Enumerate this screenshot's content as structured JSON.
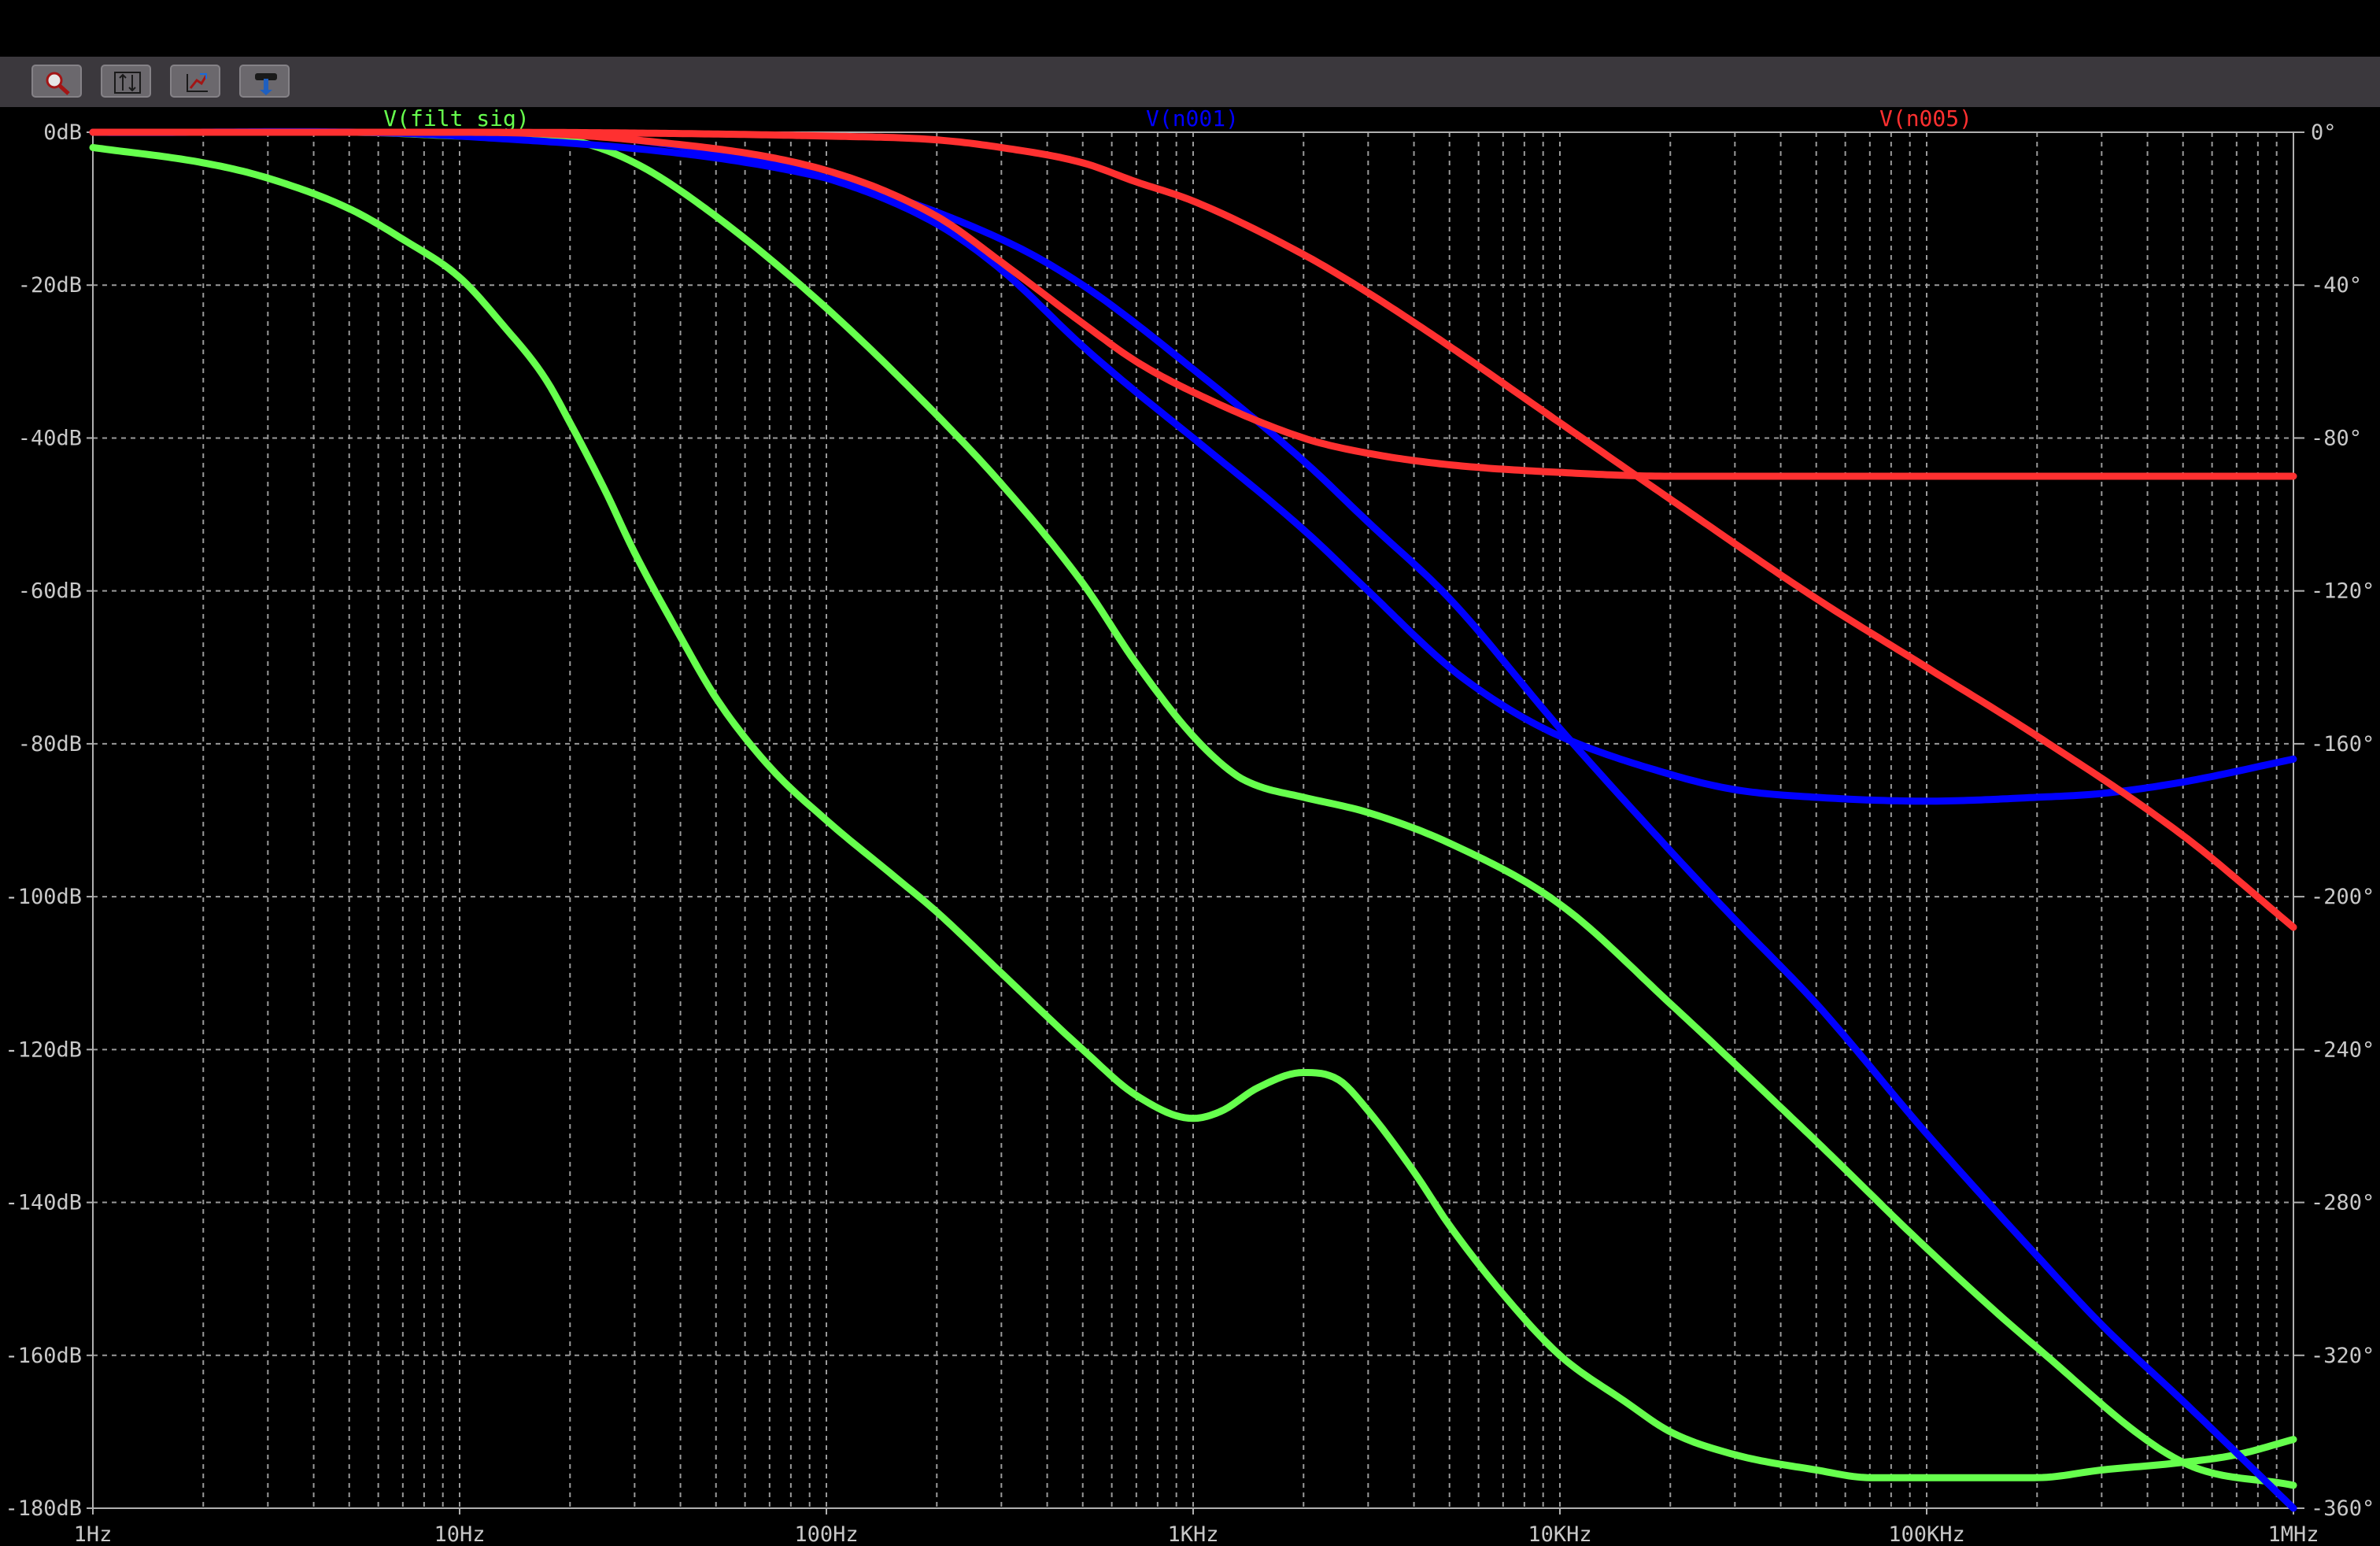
{
  "toolbar": {
    "buttons": [
      {
        "icon": "zoom-icon"
      },
      {
        "icon": "autorange-y-icon"
      },
      {
        "icon": "zoom-previous-icon"
      },
      {
        "icon": "pan-icon"
      }
    ]
  },
  "chart_data": {
    "type": "line",
    "xscale": "log",
    "xlim": [
      1,
      1000000
    ],
    "ylim": [
      -180,
      0
    ],
    "y2lim": [
      -360,
      0
    ],
    "grid": true,
    "x_tick_labels": [
      "1Hz",
      "10Hz",
      "100Hz",
      "1KHz",
      "10KHz",
      "100KHz",
      "1MHz"
    ],
    "y_tick_labels": [
      "0dB",
      "-20dB",
      "-40dB",
      "-60dB",
      "-80dB",
      "-100dB",
      "-120dB",
      "-140dB",
      "-160dB",
      "-180dB"
    ],
    "y2_tick_labels": [
      "0°",
      "-40°",
      "-80°",
      "-120°",
      "-160°",
      "-200°",
      "-240°",
      "-280°",
      "-320°",
      "-360°"
    ],
    "series": [
      {
        "name": "V(filt_sig)",
        "color": "#66ff4d",
        "axis": "magnitude",
        "style": "solid",
        "x": [
          1,
          2,
          3,
          5,
          7,
          10,
          13,
          17,
          20,
          25,
          30,
          40,
          50,
          70,
          100,
          150,
          200,
          300,
          500,
          700,
          1000,
          1200,
          1500,
          2000,
          2500,
          3000,
          4000,
          5000,
          7000,
          10000,
          15000,
          20000,
          30000,
          50000,
          70000,
          100000,
          150000,
          200000,
          300000,
          500000,
          700000,
          1000000
        ],
        "y": [
          -2,
          -4,
          -6,
          -10,
          -14,
          -19,
          -25,
          -32,
          -38,
          -47,
          -55,
          -66,
          -74,
          -83,
          -90,
          -97,
          -102,
          -110,
          -120,
          -126,
          -129,
          -128,
          -125,
          -123,
          -124,
          -128,
          -136,
          -143,
          -152,
          -160,
          -166,
          -170,
          -173,
          -175,
          -176,
          -176,
          -176,
          -176,
          -175,
          -174,
          -173,
          -171
        ]
      },
      {
        "name": "V(filt_sig) phase",
        "color": "#66ff4d",
        "axis": "phase",
        "style": "solid",
        "x": [
          1,
          5,
          10,
          20,
          30,
          50,
          100,
          200,
          300,
          500,
          700,
          1000,
          1300,
          1500,
          2000,
          3000,
          5000,
          10000,
          20000,
          50000,
          100000,
          200000,
          500000,
          1000000
        ],
        "y": [
          0,
          0,
          -1,
          -2,
          -8,
          -22,
          -46,
          -74,
          -92,
          -118,
          -139,
          -158,
          -168,
          -171,
          -174,
          -178,
          -186,
          -202,
          -228,
          -264,
          -292,
          -318,
          -348,
          -354
        ]
      },
      {
        "name": "V(n001)",
        "color": "#0000ff",
        "axis": "magnitude",
        "style": "solid",
        "x": [
          1,
          10,
          30,
          100,
          200,
          300,
          500,
          700,
          1000,
          2000,
          3000,
          5000,
          7000,
          10000,
          20000,
          30000,
          50000,
          100000,
          200000,
          300000,
          500000,
          1000000
        ],
        "y": [
          0,
          0,
          -1,
          -6,
          -12,
          -18,
          -28,
          -34,
          -40,
          -52,
          -60,
          -70,
          -75,
          -79,
          -84,
          -86,
          -87,
          -87.5,
          -87,
          -86.5,
          -85,
          -82
        ]
      },
      {
        "name": "V(n001) phase",
        "color": "#0000ff",
        "axis": "phase",
        "style": "solid",
        "x": [
          1,
          10,
          100,
          300,
          500,
          1000,
          2000,
          3000,
          5000,
          10000,
          20000,
          30000,
          50000,
          100000,
          200000,
          300000,
          500000,
          1000000
        ],
        "y": [
          0,
          -1,
          -12,
          -28,
          -40,
          -62,
          -86,
          -102,
          -122,
          -156,
          -188,
          -206,
          -228,
          -262,
          -294,
          -312,
          -332,
          -360
        ]
      },
      {
        "name": "V(n005)",
        "color": "#ff3030",
        "axis": "magnitude",
        "style": "solid",
        "x": [
          1,
          10,
          30,
          100,
          200,
          300,
          500,
          700,
          1000,
          2000,
          3000,
          5000,
          10000,
          20000,
          30000,
          50000,
          100000,
          1000000
        ],
        "y": [
          0,
          0,
          -1,
          -5,
          -11,
          -17,
          -25,
          -30,
          -34,
          -40,
          -42,
          -43.5,
          -44.5,
          -45,
          -45,
          -45,
          -45,
          -45
        ]
      },
      {
        "name": "V(n005) phase",
        "color": "#ff3030",
        "axis": "phase",
        "style": "solid",
        "x": [
          1,
          10,
          100,
          200,
          300,
          500,
          700,
          1000,
          2000,
          3000,
          5000,
          10000,
          20000,
          50000,
          100000,
          200000,
          500000,
          1000000
        ],
        "y": [
          0,
          0,
          -1,
          -2,
          -4,
          -8,
          -13,
          -18,
          -32,
          -42,
          -56,
          -76,
          -96,
          -122,
          -140,
          -158,
          -184,
          -208
        ]
      }
    ]
  }
}
